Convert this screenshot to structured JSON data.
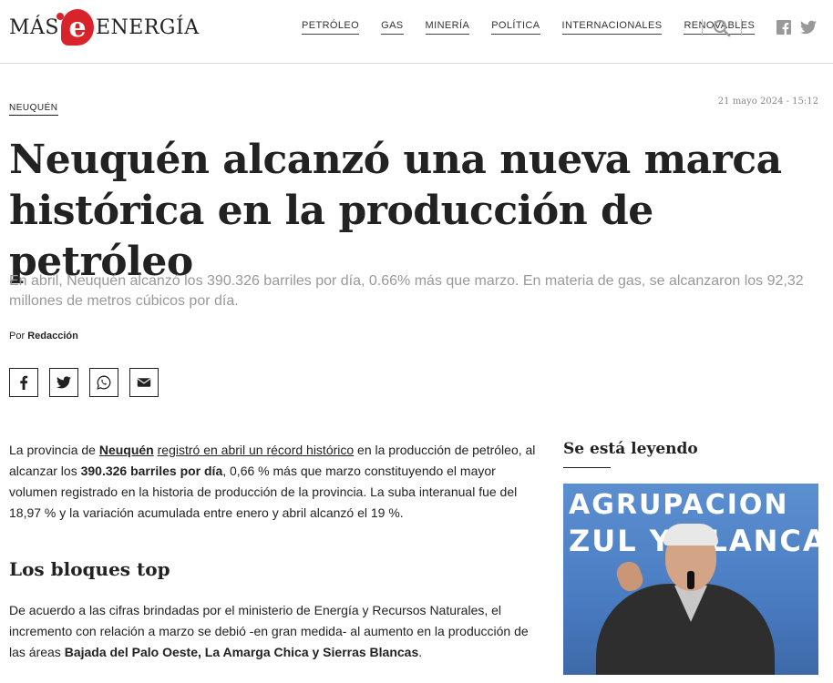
{
  "header": {
    "logo_left": "MÁS",
    "logo_mark": "e",
    "logo_right": "ENERGÍA",
    "nav": [
      "PETRÓLEO",
      "GAS",
      "MINERÍA",
      "POLÍTICA",
      "INTERNACIONALES",
      "RENOVABLES"
    ],
    "icons": [
      "search-icon",
      "facebook-icon",
      "twitter-icon"
    ]
  },
  "article": {
    "category": "NEUQUÉN",
    "date": "21 mayo 2024 - 15:12",
    "title": "Neuquén alcanzó una nueva marca histórica en la producción de petróleo",
    "subtitle": "En abril, Neuquén alcanzó los 390.326 barriles por día, 0.66% más que marzo. En materia de gas, se alcanzaron los 92,32 millones de metros cúbicos por día.",
    "byline_prefix": "Por",
    "author": "Redacción",
    "share": [
      "facebook-icon",
      "twitter-icon",
      "whatsapp-icon",
      "email-icon"
    ],
    "p1": {
      "t1": "La provincia de ",
      "link1": "Neuquén",
      "t2": " ",
      "link2": "registró en abril un récord histórico",
      "t3": " en la producción de petróleo, al alcanzar los ",
      "bold": "390.326 barriles por día",
      "t4": ", 0,66 % más que marzo constituyendo el mayor volumen registrado en la historia de producción de la provincia. La suba interanual fue del 18,97 % y la variación acumulada entre enero y abril alcanzó el 19 %."
    },
    "h2": "Los bloques top",
    "p2": {
      "t1": "De acuerdo a las cifras brindadas por el ministerio de Energía y Recursos Naturales, el incremento con relación a marzo se debió -en gran medida- al aumento en la producción de las áreas ",
      "bold": "Bajada del Palo Oeste, La Amarga Chica y Sierras Blancas",
      "t2": "."
    }
  },
  "sidebar": {
    "title": "Se está leyendo",
    "image_banner_line1": "AGRUPACION",
    "image_banner_line2": "ZUL Y BLANCA"
  }
}
